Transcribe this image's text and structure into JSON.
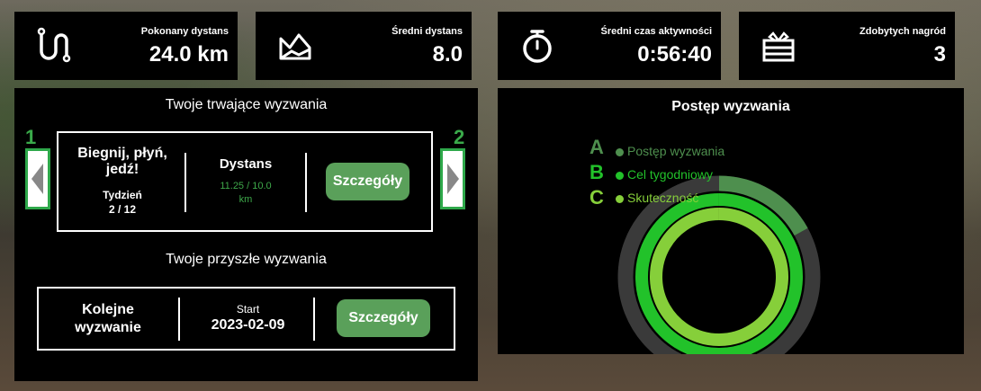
{
  "stats": [
    {
      "label": "Pokonany dystans",
      "value": "24.0 km",
      "icon": "route-icon"
    },
    {
      "label": "Średni dystans",
      "value": "8.0",
      "icon": "terrain-icon"
    },
    {
      "label": "Średni czas aktywności",
      "value": "0:56:40",
      "icon": "stopwatch-icon"
    },
    {
      "label": "Zdobytych nagród",
      "value": "3",
      "icon": "gift-icon"
    }
  ],
  "ongoing": {
    "title": "Twoje trwające wyzwania",
    "name": "Biegnij, płyń, jedź!",
    "week_label": "Tydzień",
    "week_value": "2 / 12",
    "metric_label": "Dystans",
    "metric_value": "11.25 / 10.0 km",
    "details_label": "Szczegóły",
    "left_number": "1",
    "right_number": "2"
  },
  "future": {
    "title": "Twoje przyszłe wyzwania",
    "name": "Kolejne wyzwanie",
    "start_label": "Start",
    "start_value": "2023-02-09",
    "details_label": "Szczegóły"
  },
  "progress": {
    "title": "Postęp wyzwania",
    "legend": [
      {
        "letter": "A",
        "label": "Postęp wyzwania",
        "color": "#4e8f4e",
        "fraction": 0.17
      },
      {
        "letter": "B",
        "label": "Cel tygodniowy",
        "color": "#22c22a",
        "fraction": 1.0
      },
      {
        "letter": "C",
        "label": "Skuteczność",
        "color": "#86cf3a",
        "fraction": 1.0
      }
    ],
    "track_color": "#3a3a3a"
  }
}
